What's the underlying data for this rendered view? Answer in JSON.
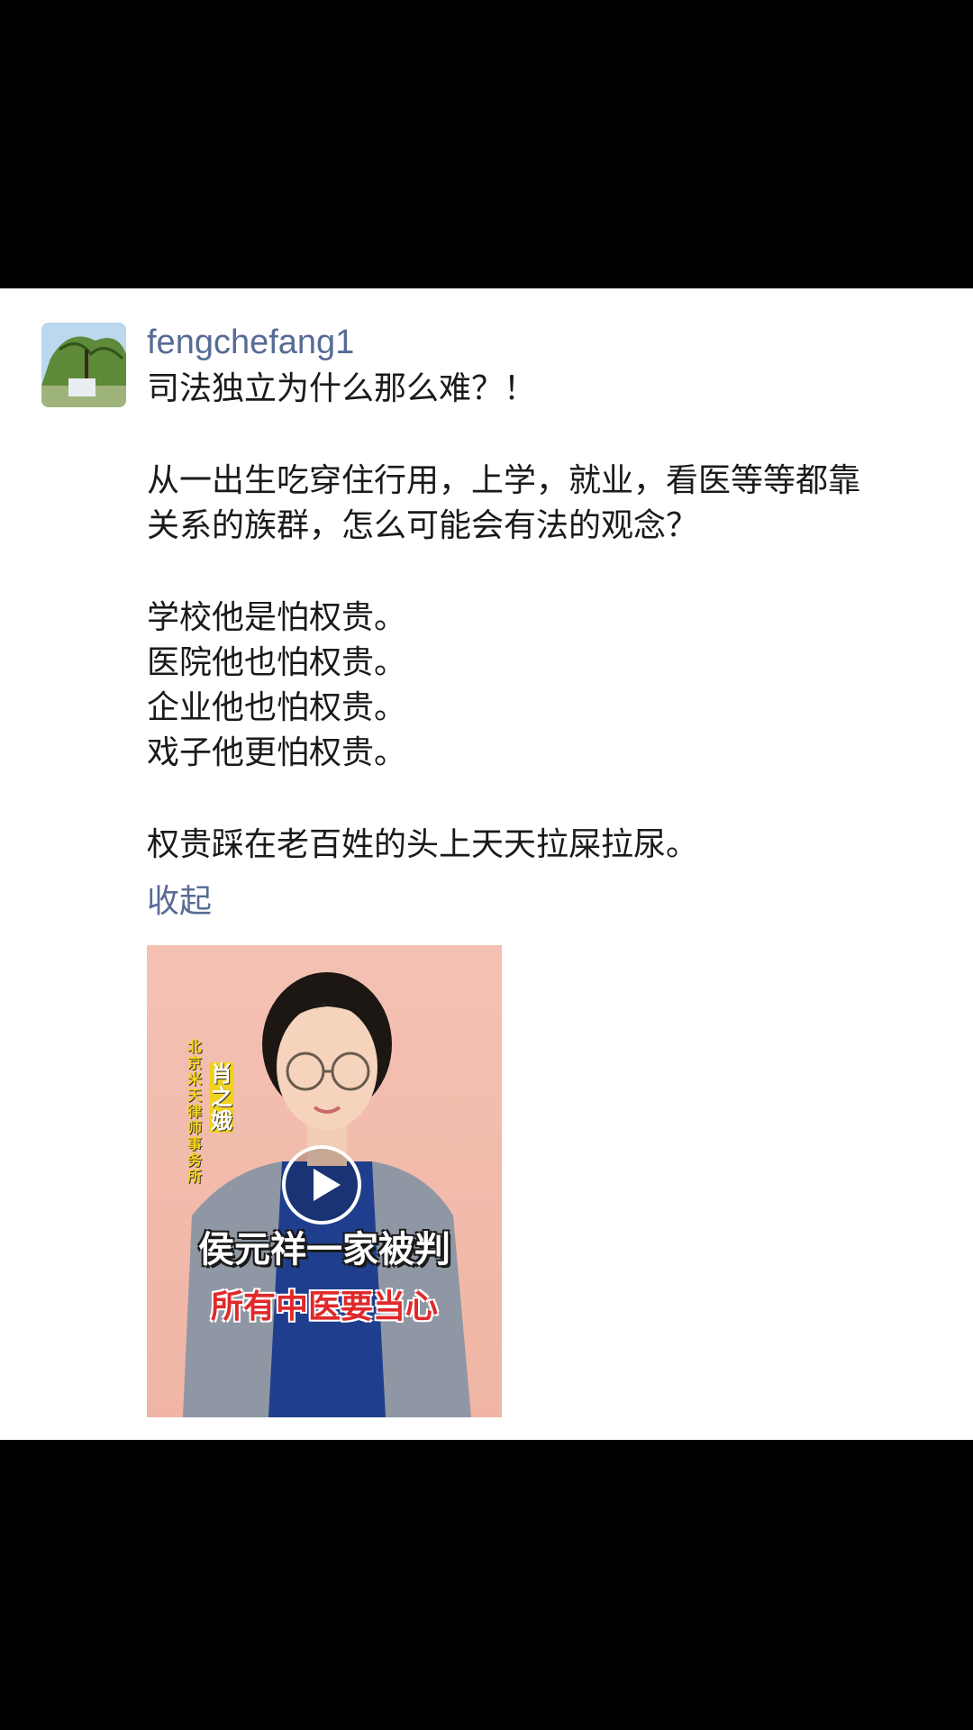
{
  "post": {
    "username": "fengchefang1",
    "lines": [
      "司法独立为什么那么难？！",
      "",
      "从一出生吃穿住行用，上学，就业，看医等等都靠",
      "关系的族群，怎么可能会有法的观念？",
      "",
      "学校他是怕权贵。",
      "医院他也怕权贵。",
      "企业他也怕权贵。",
      "戏子他更怕权贵。",
      "",
      "权贵踩在老百姓的头上天天拉屎拉尿。"
    ],
    "collapse_label": "收起"
  },
  "video": {
    "headline": "侯元祥一家被判",
    "subheadline": "所有中医要当心",
    "firm_text": "北京米天律师事务所",
    "person_name": "肖之娥",
    "play_icon": "play-icon"
  },
  "colors": {
    "link": "#576b95",
    "text": "#1a1a1a",
    "video_bg": "#f0b5a5",
    "headline_sub": "#e0292a"
  }
}
